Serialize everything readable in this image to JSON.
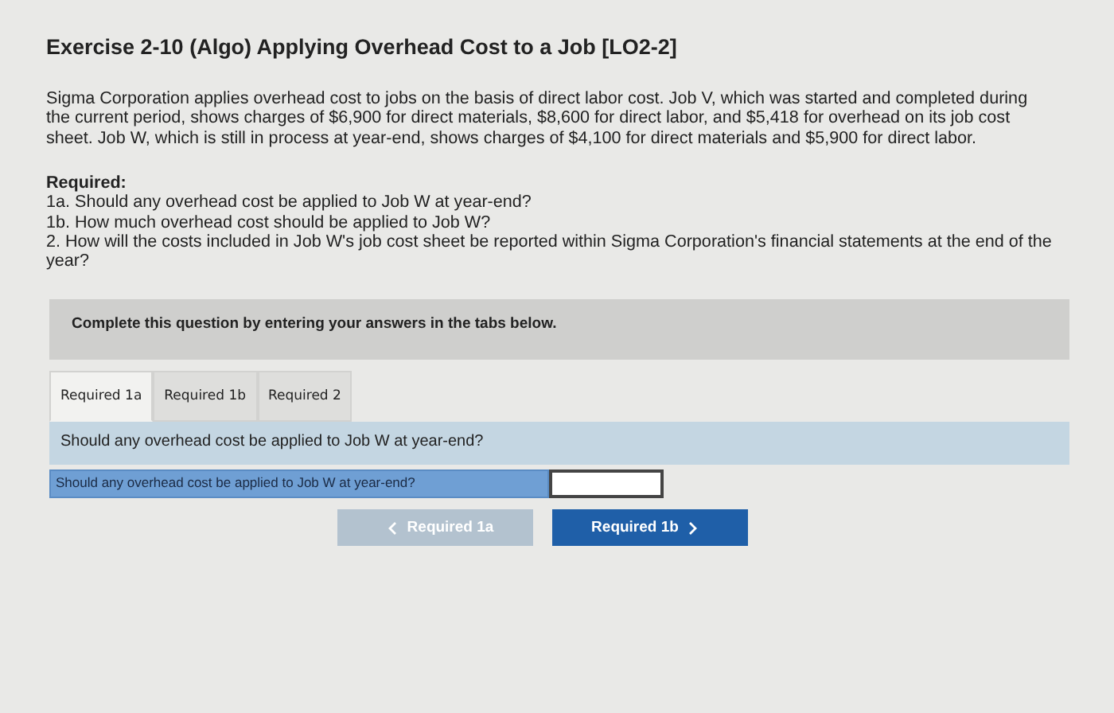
{
  "title": "Exercise 2-10 (Algo) Applying Overhead Cost to a Job [LO2-2]",
  "problem": "Sigma Corporation applies overhead cost to jobs on the basis of direct labor cost. Job V, which was started and completed during the current period, shows charges of $6,900 for direct materials, $8,600 for direct labor, and $5,418 for overhead on its job cost sheet. Job W, which is still in process at year-end, shows charges of $4,100 for direct materials and $5,900 for direct labor.",
  "required": {
    "heading": "Required:",
    "items": [
      "1a. Should any overhead cost be applied to Job W at year-end?",
      "1b. How much overhead cost should be applied to Job W?",
      "2. How will the costs included in Job W's job cost sheet be reported within Sigma Corporation's financial statements at the end of the year?"
    ]
  },
  "instructions": "Complete this question by entering your answers in the tabs below.",
  "tabs": [
    {
      "label": "Required 1a",
      "selected": true
    },
    {
      "label": "Required 1b",
      "selected": false
    },
    {
      "label": "Required 2",
      "selected": false
    }
  ],
  "question": "Should any overhead cost be applied to Job W at year-end?",
  "answer_row": {
    "label": "Should any overhead cost be applied to Job W at year-end?"
  },
  "nav": [
    {
      "kind": "prev",
      "label": "Required 1a",
      "disabled": true
    },
    {
      "kind": "next",
      "label": "Required 1b",
      "disabled": false
    }
  ]
}
